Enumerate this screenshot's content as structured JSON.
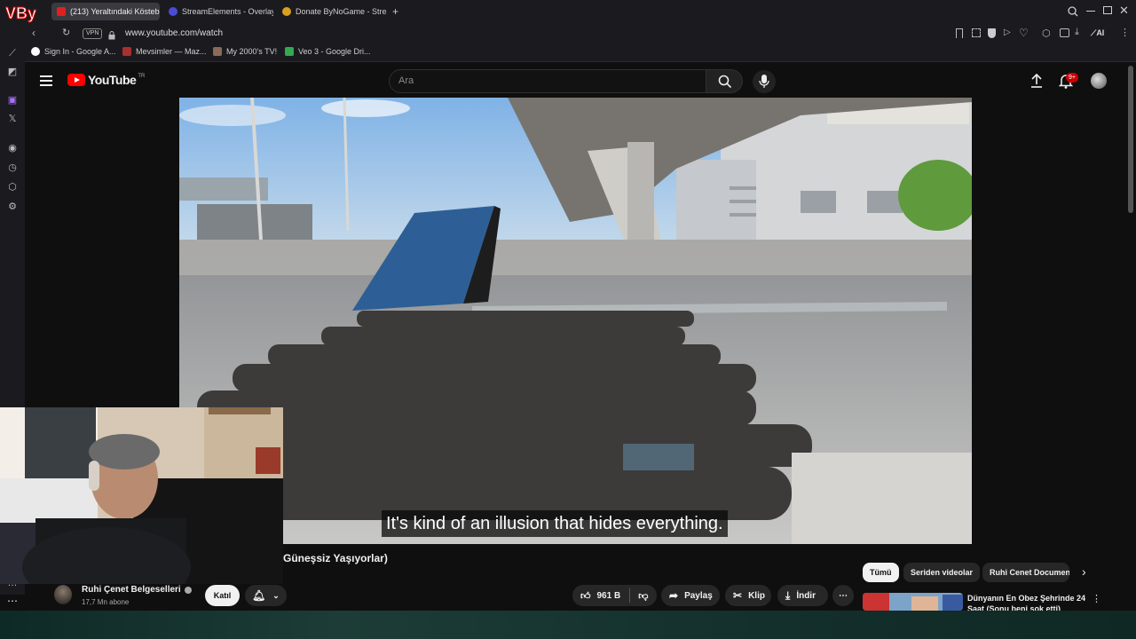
{
  "browser": {
    "tabs": [
      {
        "label": "(213) Yeraltındaki Köstebe",
        "color": "#e02020",
        "active": true
      },
      {
        "label": "StreamElements - Overlay",
        "color": "#4b4bd6",
        "active": false
      },
      {
        "label": "Donate ByNoGame - Strea",
        "color": "#d8a020",
        "active": false
      }
    ],
    "new_tab": "+",
    "vpn_label": "VPN",
    "url": "www.youtube.com/watch",
    "ai_label": "AI",
    "bookmarks": [
      {
        "label": "Sign In - Google A...",
        "color": "#ffffff"
      },
      {
        "label": "Mevsimler — Maz...",
        "color": "#aa3030"
      },
      {
        "label": "My 2000's TV!",
        "color": "#8a6a5a"
      },
      {
        "label": "Veo 3 - Google Dri...",
        "color": "#34a853"
      }
    ]
  },
  "youtube": {
    "logo_text": "YouTube",
    "logo_sup": "TR",
    "search_placeholder": "Ara",
    "notification_badge": "9+",
    "subtitle": "It's kind of an illusion that hides everything.",
    "title_fragment": "Güneşsiz Yaşıyorlar)",
    "channel_name": "Ruhi Çenet Belgeselleri",
    "subscribers": "17,7 Mn abone",
    "join_label": "Katıl",
    "likes": "961 B",
    "share_label": "Paylaş",
    "clip_label": "Klip",
    "download_label": "İndir",
    "chips": [
      "Tümü",
      "Seriden videolar",
      "Ruhi Cenet Documen"
    ],
    "rec_title": "Dünyanın En Obez Şehrinde 24 Saat (Sonu beni şok etti)",
    "accent": "#ff0000"
  }
}
